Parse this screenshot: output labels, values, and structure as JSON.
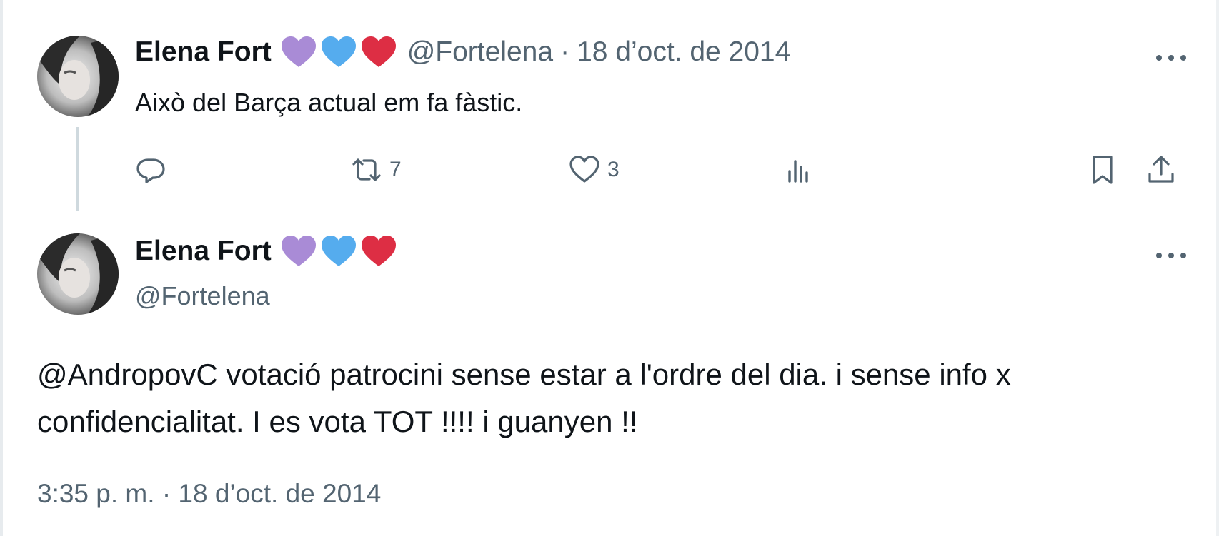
{
  "parent_tweet": {
    "display_name": "Elena Fort",
    "emoji": [
      "purple-heart",
      "blue-heart",
      "red-heart"
    ],
    "handle": "@Fortelena",
    "separator": "·",
    "date": "18 d’oct. de 2014",
    "text": "Això del Barça actual em fa fàstic.",
    "actions": {
      "reply_count": "",
      "retweet_count": "7",
      "like_count": "3",
      "views_count": ""
    }
  },
  "main_tweet": {
    "display_name": "Elena Fort",
    "emoji": [
      "purple-heart",
      "blue-heart",
      "red-heart"
    ],
    "handle": "@Fortelena",
    "text_line1": "@AndropovC votació patrocini sense estar a l'ordre del dia. i sense info x",
    "text_line2": "confidencialitat. I es vota TOT !!!! i guanyen !!",
    "time": "3:35 p. m.",
    "separator": "·",
    "date": "18 d’oct. de 2014"
  },
  "colors": {
    "text_primary": "#0f1419",
    "text_secondary": "#536471",
    "thread_line": "#cfd9de",
    "purple_heart": "#a98bd6",
    "blue_heart": "#55acee",
    "red_heart": "#dd2e44"
  },
  "icons": {
    "more": "more-horizontal-icon",
    "reply": "reply-icon",
    "retweet": "retweet-icon",
    "like": "like-icon",
    "views": "views-icon",
    "bookmark": "bookmark-icon",
    "share": "share-icon"
  }
}
